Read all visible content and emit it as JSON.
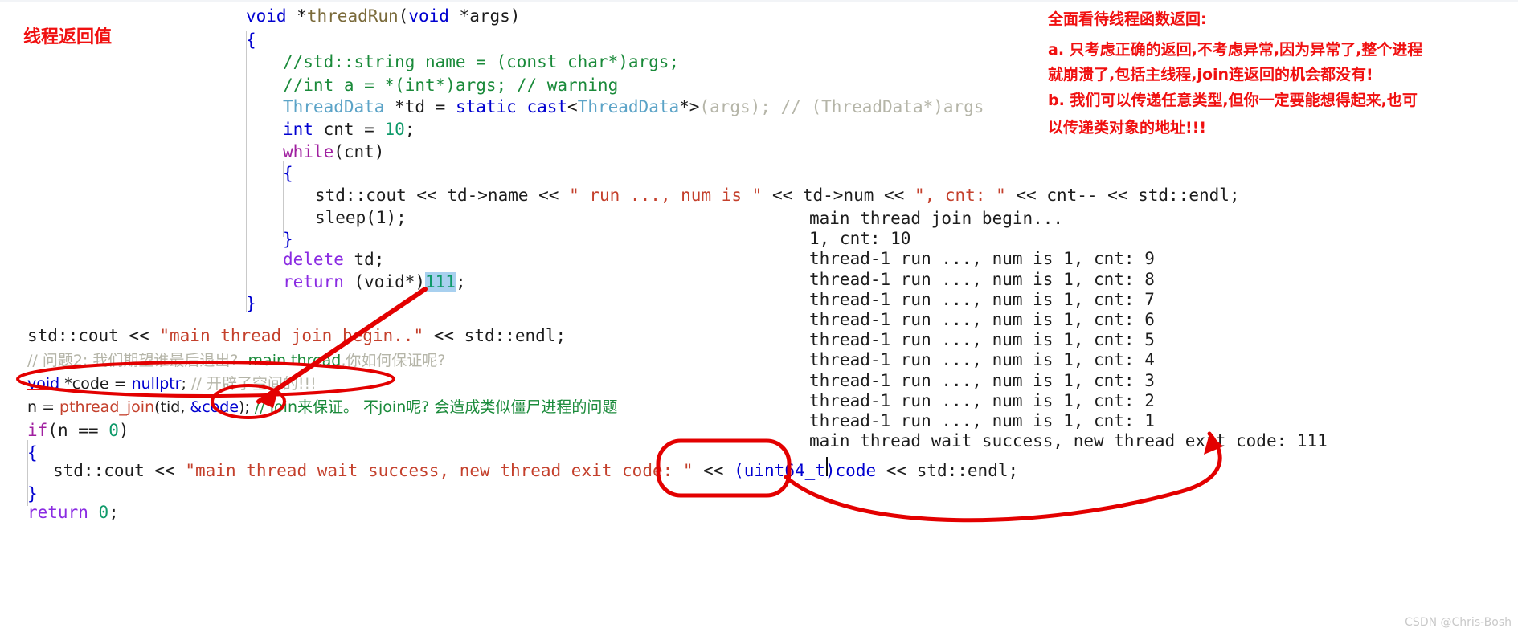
{
  "title_label": "线程返回值",
  "watermark": "CSDN @Chris-Bosh",
  "colors": {
    "annotation_red": "#f01010",
    "keyword_blue": "#0000d0",
    "string_red": "#c4402c",
    "comment_green": "#1a8a3a",
    "type_cyan": "#5ba3c7",
    "selection_blue": "#a8d0ef"
  },
  "red_notes": {
    "heading": "全面看待线程函数返回:",
    "line_a1": "a. 只考虑正确的返回,不考虑异常,因为异常了,整个进程",
    "line_a2": "就崩溃了,包括主线程,join连返回的机会都没有!",
    "line_b1": "b. 我们可以传递任意类型,但你一定要能想得起来,也可",
    "line_b2": "以传递类对象的地址!!!"
  },
  "code_top": {
    "l1_t1": "void",
    "l1_t2": " *",
    "l1_t3": "threadRun",
    "l1_t4": "(",
    "l1_t5": "void",
    "l1_t6": " *args)",
    "l2": "{",
    "l3": "//std::string name = (const char*)args;",
    "l4": "//int a = *(int*)args; // warning",
    "l5_type": "ThreadData",
    "l5_mid": " *td = ",
    "l5_cast": "static_cast",
    "l5_lt": "<",
    "l5_type2": "ThreadData",
    "l5_gt": "*>",
    "l5_args": "(args);",
    "l5_cmt": " // (ThreadData*)args",
    "l6_kw": "int",
    "l6_mid": " cnt = ",
    "l6_num": "10",
    "l6_end": ";",
    "l7_kw": "while",
    "l7_rest": "(cnt)",
    "l8": "{",
    "l9_a": "std::cout << td->name << ",
    "l9_s1": "\" run ..., num is \"",
    "l9_b": " << td->num << ",
    "l9_s2": "\", cnt: \"",
    "l9_c": " << cnt-- << std::endl;",
    "l10": "sleep(1);",
    "l11": "}",
    "l12_kw": "delete",
    "l12_rest": " td;",
    "l13_kw": "return",
    "l13_mid": " (void*)",
    "l13_num": "111",
    "l13_end": ";",
    "l14": "}"
  },
  "code_bottom": {
    "b1_a": "std::cout << ",
    "b1_s": "\"main thread join begin..\"",
    "b1_b": " << std::endl;",
    "b2": "// 问题2: 我们期望谁最后退出?  main thread,你如何保证呢?",
    "b2_p1": "// 问题2: 我们期望谁最后退出?  ",
    "b2_p2": "main thread",
    "b2_p3": ",你如何保证呢?",
    "b3_kw": "void",
    "b3_mid": " *code = ",
    "b3_null": "nullptr",
    "b3_semi": ";",
    "b3_cmt": " // 开辟了空间的!!!",
    "b4_a": "n = ",
    "b4_fn": "pthread_join",
    "b4_b": "(tid, ",
    "b4_code": "&code",
    "b4_c": ");",
    "b4_cmt": " // join来保证。 不join呢? 会造成类似僵尸进程的问题",
    "b5_kw": "if",
    "b5_rest1": "(n ",
    "b5_eq": "==",
    "b5_rest2": " ",
    "b5_num": "0",
    "b5_rest3": ")",
    "b6": "{",
    "b7_a": "std::cout << ",
    "b7_s": "\"main thread wait success, new thread exit code: \"",
    "b7_b": " << ",
    "b7_cast": "(uint64_t)code",
    "b7_c": " << std::endl;",
    "b8": "}",
    "b9_kw": "return",
    "b9_num": " 0",
    "b9_end": ";"
  },
  "terminal": {
    "lines": [
      "main thread join begin...",
      "1, cnt: 10",
      "thread-1 run ..., num is 1, cnt: 9",
      "thread-1 run ..., num is 1, cnt: 8",
      "thread-1 run ..., num is 1, cnt: 7",
      "thread-1 run ..., num is 1, cnt: 6",
      "thread-1 run ..., num is 1, cnt: 5",
      "thread-1 run ..., num is 1, cnt: 4",
      "thread-1 run ..., num is 1, cnt: 3",
      "thread-1 run ..., num is 1, cnt: 2",
      "thread-1 run ..., num is 1, cnt: 1",
      "main thread wait success, new thread exit code: 111"
    ]
  }
}
